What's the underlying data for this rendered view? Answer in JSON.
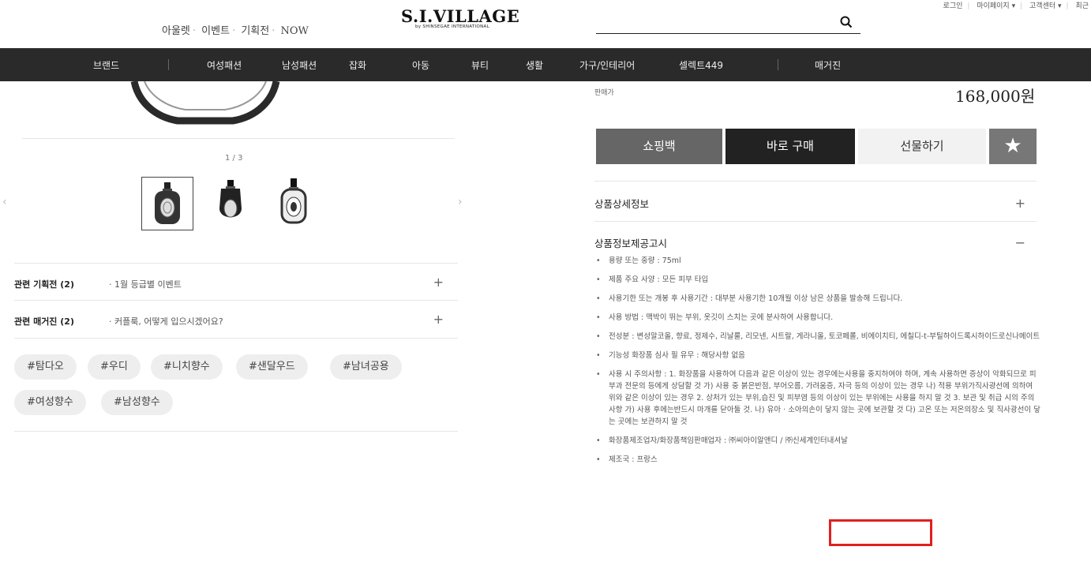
{
  "header": {
    "top_links": [
      "아울렛",
      "이벤트",
      "기획전",
      "NOW"
    ],
    "logo_main": "S.I.VILLAGE",
    "logo_sub": "by SHINSEGAE INTERNATIONAL",
    "search_placeholder": "",
    "utility": [
      "로그인",
      "마이페이지 ▾",
      "고객센터 ▾",
      "최근"
    ]
  },
  "main_nav": [
    "브랜드",
    "여성패션",
    "남성패션",
    "잡화",
    "아동",
    "뷰티",
    "생활",
    "가구/인테리어",
    "셀렉트449",
    "매거진"
  ],
  "gallery": {
    "counter": "1 / 3",
    "prev": "‹",
    "next": "›"
  },
  "related": [
    {
      "label": "관련 기획전 (2)",
      "value": "· 1월 등급별 이벤트",
      "toggle": "+"
    },
    {
      "label": "관련 매거진 (2)",
      "value": "· 커플룩, 어떻게 입으시겠어요?",
      "toggle": "+"
    }
  ],
  "tags": [
    "#탐다오",
    "#우디",
    "#니치향수",
    "#샌달우드",
    "#남녀공용",
    "#여성향수",
    "#남성향수"
  ],
  "price": {
    "label": "판매가",
    "value": "168,000원"
  },
  "buttons": {
    "cart": "쇼핑백",
    "buy": "바로 구매",
    "gift": "선물하기",
    "wish": "★"
  },
  "sections": [
    {
      "title": "상품상세정보",
      "sign": "+"
    },
    {
      "title": "상품정보제공고시",
      "sign": "−"
    }
  ],
  "notice_items": [
    "용량 또는 중량 : 75ml",
    "제품 주요 사양 : 모든 피부 타입",
    "사용기한 또는 개봉 후 사용기간 : 대부분 사용기한 10개월 이상 남은 상품을 발송해 드립니다.",
    "사용 방법 : 맥박이 뛰는 부위, 옷깃이 스치는 곳에 분사하여 사용합니다.",
    "전성분 : 변성알코올, 향료, 정제수, 리날룰, 리모넨, 시트랄, 게라니올, 토코페롤, 비에이치티, 에칠디-t-부틸하이드록시하이드로신나메이트",
    "기능성 화장품 심사 필 유무 : 해당사항 없음",
    "사용 시 주의사항 : 1. 화장품을 사용하여 다음과 같은 이상이 있는 경우에는사용을 중지하여야 하며, 계속 사용하면 증상이 악화되므로 피부과 전문의 등에게 상담할 것 가) 사용 중 붉은반점, 부어오름, 가려움증, 자극 등의 이상이 있는 경우 나) 적용 부위가직사광선에 의하여 위와 같은 이상이 있는 경우 2. 상처가 있는 부위,습진 및 피부염 등의 이상이 있는 부위에는 사용을 하지 말 것 3. 보관 및 취급 시의 주의사항 가) 사용 후에는반드시 마개를 닫아둘 것. 나) 유아 · 소아의손이 닿지 않는 곳에 보관할 것 다) 고온 또는 저온의장소 및 직사광선이 닿는 곳에는 보관하지 말 것",
    "화장품제조업자/화장품책임판매업자 : ㈜씨아이알앤디 / ㈜신세계인터내셔날",
    "제조국 : 프랑스"
  ],
  "colors": {
    "nav_bg": "#2a2a2a",
    "cart_btn": "#666666",
    "buy_btn": "#222222",
    "gift_btn": "#f2f2f2",
    "wish_btn": "#777777",
    "highlight": "#e0201e"
  }
}
